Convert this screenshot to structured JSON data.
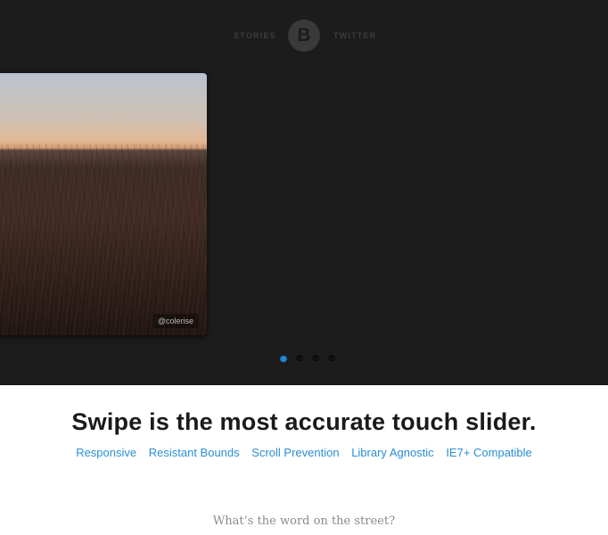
{
  "nav": {
    "left_link": "STORIES",
    "logo_letter": "B",
    "right_link": "TWITTER"
  },
  "slider": {
    "photo_credit": "@colerise",
    "total_slides": 4,
    "active_slide": 1,
    "active_color": "#1e8bd4"
  },
  "hero": {
    "headline": "Swipe is the most accurate touch slider."
  },
  "features": [
    "Responsive",
    "Resistant Bounds",
    "Scroll Prevention",
    "Library Agnostic",
    "IE7+ Compatible"
  ],
  "street": {
    "question": "What’s the word on the street?"
  },
  "colors": {
    "hero_background": "#1c1c1c",
    "link": "#2a8fd1",
    "headline": "#1a1a1a"
  }
}
